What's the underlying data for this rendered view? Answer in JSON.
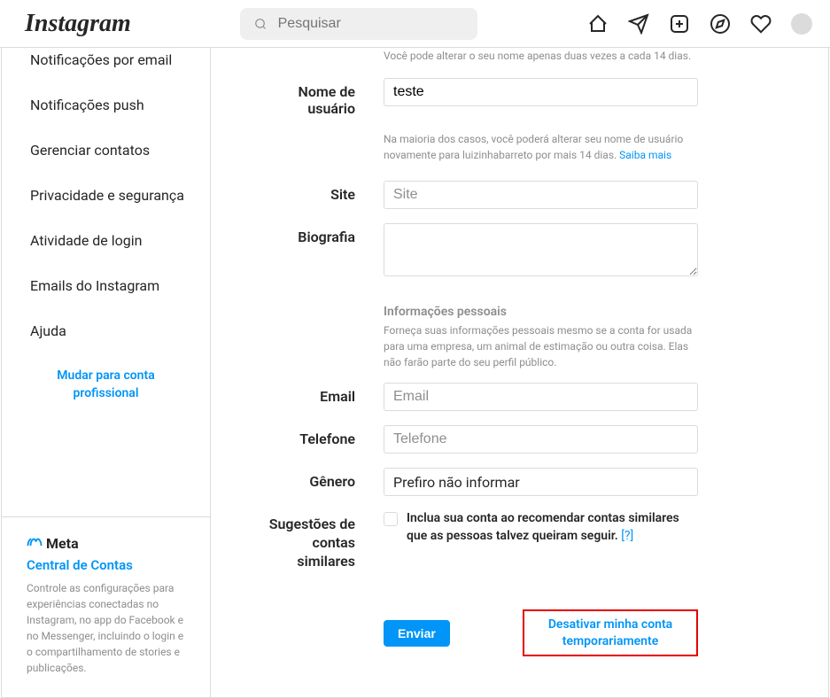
{
  "header": {
    "logo": "Instagram",
    "search_placeholder": "Pesquisar"
  },
  "sidebar": {
    "items": [
      {
        "label": "Notificações por email"
      },
      {
        "label": "Notificações push"
      },
      {
        "label": "Gerenciar contatos"
      },
      {
        "label": "Privacidade e segurança"
      },
      {
        "label": "Atividade de login"
      },
      {
        "label": "Emails do Instagram"
      },
      {
        "label": "Ajuda"
      }
    ],
    "switch_label": "Mudar para conta profissional",
    "footer": {
      "meta": "Meta",
      "central": "Central de Contas",
      "desc": "Controle as configurações para experiências conectadas no Instagram, no app do Facebook e no Messenger, incluindo o login e o compartilhamento de stories e publicações."
    }
  },
  "form": {
    "name_help": "Você pode alterar o seu nome apenas duas vezes a cada 14 dias.",
    "username_label": "Nome de usuário",
    "username_value": "teste",
    "username_help_1": "Na maioria dos casos, você poderá alterar seu nome de usuário novamente para luizinhabarreto por mais 14 dias. ",
    "username_help_link": "Saiba mais",
    "site_label": "Site",
    "site_placeholder": "Site",
    "bio_label": "Biografia",
    "personal_heading": "Informações pessoais",
    "personal_desc": "Forneça suas informações pessoais mesmo se a conta for usada para uma empresa, um animal de estimação ou outra coisa. Elas não farão parte do seu perfil público.",
    "email_label": "Email",
    "email_placeholder": "Email",
    "phone_label": "Telefone",
    "phone_placeholder": "Telefone",
    "gender_label": "Gênero",
    "gender_value": "Prefiro não informar",
    "suggestions_label_1": "Sugestões de",
    "suggestions_label_2": "contas similares",
    "suggestions_checkbox": "Inclua sua conta ao recomendar contas similares que as pessoas talvez queiram seguir.",
    "suggestions_help": "[?]",
    "submit": "Enviar",
    "deactivate": "Desativar minha conta temporariamente"
  }
}
